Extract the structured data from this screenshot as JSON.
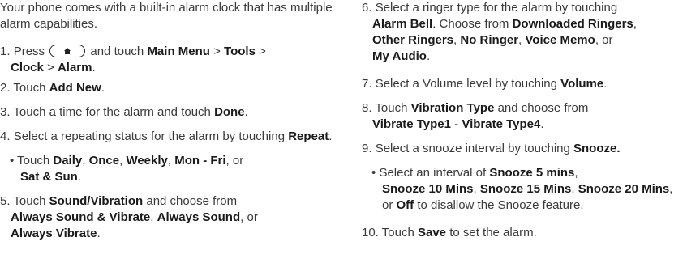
{
  "left": {
    "intro": "Your phone comes with a built-in alarm clock that has multiple alarm capabilities.",
    "step1": {
      "num": "1.",
      "pre": "Press",
      "key_icon": "home-key-icon",
      "mid": "and touch",
      "main_menu": "Main Menu",
      "sep1": " > ",
      "tools": "Tools",
      "sep2": " > ",
      "clock": "Clock",
      "sep3": " > ",
      "alarm": "Alarm",
      "end": "."
    },
    "step2": {
      "num": "2.",
      "pre": "Touch",
      "add_new": "Add New",
      "end": "."
    },
    "step3": {
      "num": "3.",
      "pre": "Touch a time for the alarm and touch",
      "done": "Done",
      "end": "."
    },
    "step4": {
      "num": "4.",
      "pre": "Select a repeating status for the alarm by touching",
      "repeat": "Repeat",
      "end": ".",
      "bullet": "•",
      "sub_pre": "Touch",
      "daily": "Daily",
      "c1": ",",
      "once": "Once",
      "c2": ",",
      "weekly": "Weekly",
      "c3": ",",
      "monfri": "Mon - Fri",
      "c4": ", or",
      "satsun": "Sat & Sun",
      "sub_end": "."
    },
    "step5": {
      "num": "5.",
      "pre": "Touch",
      "sound_vib": "Sound/Vibration",
      "mid": "and choose from",
      "always_sv": "Always Sound & Vibrate",
      "c1": ",",
      "always_s": "Always Sound",
      "c2": ", or",
      "always_v": "Always Vibrate",
      "end": "."
    }
  },
  "right": {
    "step6": {
      "num": "6.",
      "pre": "Select a ringer type for the alarm by touching",
      "alarm_bell": "Alarm Bell",
      "mid": ". Choose from",
      "downloaded": "Downloaded Ringers",
      "c1": ",",
      "other": "Other Ringers",
      "c2": ",",
      "no_ringer": "No Ringer",
      "c3": ",",
      "voice_memo": "Voice Memo",
      "c4": ", or",
      "my_audio": "My Audio",
      "end": "."
    },
    "step7": {
      "num": "7.",
      "pre": "Select a Volume level by touching",
      "volume": "Volume",
      "end": "."
    },
    "step8": {
      "num": "8.",
      "pre": "Touch",
      "vib_type": "Vibration Type",
      "mid": "and choose from",
      "vib1": "Vibrate Type1",
      "dash": " - ",
      "vib4": "Vibrate Type4",
      "end": "."
    },
    "step9": {
      "num": "9.",
      "pre": "Select a snooze interval by touching",
      "snooze": "Snooze.",
      "bullet": "•",
      "sub_pre": "Select an interval of",
      "s5": "Snooze 5 mins",
      "c1": ",",
      "s10": "Snooze 10 Mins",
      "c2": ",",
      "s15": "Snooze 15 Mins",
      "c3": ",",
      "s20": "Snooze 20 Mins",
      "c4": ",",
      "or": "or",
      "off": "Off",
      "sub_end": "to disallow the Snooze feature."
    },
    "step10": {
      "num": "10.",
      "pre": "Touch",
      "save": "Save",
      "end": "to set the alarm."
    }
  }
}
